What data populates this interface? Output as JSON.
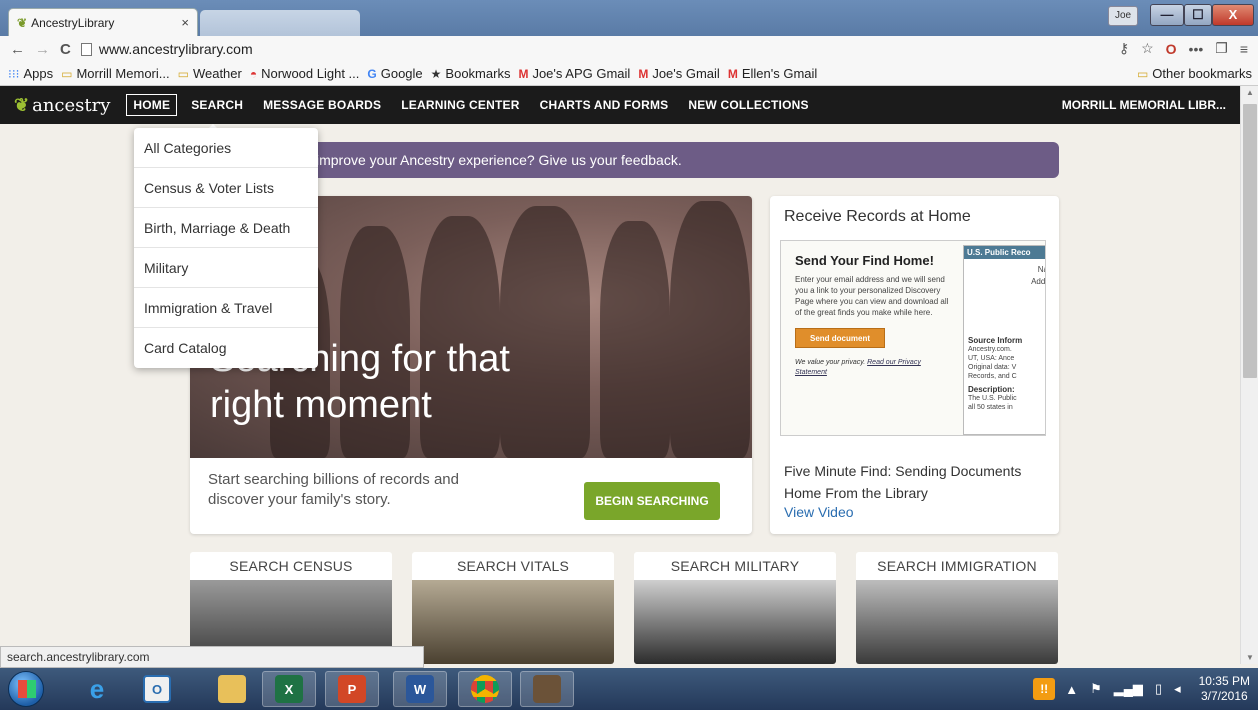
{
  "browser": {
    "tab_title": "AncestryLibrary",
    "tab_close": "×",
    "url": "www.ancestrylibrary.com",
    "user_badge": "Joe",
    "min": "—",
    "max": "☐",
    "close": "X",
    "back": "←",
    "forward": "→",
    "reload": "C",
    "bookmarks": [
      {
        "icon": "apps-icon",
        "label": "Apps"
      },
      {
        "icon": "folder-icon",
        "label": "Morrill Memori..."
      },
      {
        "icon": "folder-icon",
        "label": "Weather"
      },
      {
        "icon": "norwood-icon",
        "label": "Norwood Light ..."
      },
      {
        "icon": "google-icon",
        "label": "Google"
      },
      {
        "icon": "star-icon",
        "label": "Bookmarks"
      },
      {
        "icon": "gmail-icon",
        "label": "Joe's APG Gmail"
      },
      {
        "icon": "gmail-icon",
        "label": "Joe's Gmail"
      },
      {
        "icon": "gmail-icon",
        "label": "Ellen's Gmail"
      }
    ],
    "other_bookmarks": "Other bookmarks",
    "status_url": "search.ancestrylibrary.com"
  },
  "site": {
    "logo": "ancestry",
    "nav": {
      "home": "HOME",
      "search": "SEARCH",
      "message_boards": "MESSAGE BOARDS",
      "learning_center": "LEARNING CENTER",
      "charts_forms": "CHARTS AND FORMS",
      "new_collections": "NEW COLLECTIONS",
      "library": "MORRILL MEMORIAL LIBR..."
    },
    "dropdown": [
      "All Categories",
      "Census & Voter Lists",
      "Birth, Marriage & Death",
      "Military",
      "Immigration & Travel",
      "Card Catalog"
    ],
    "feedback": "improve your Ancestry experience? Give us your feedback.",
    "hero": {
      "headline_1": "Searching for that",
      "headline_2": "right moment",
      "subtext": "Start searching billions of records and discover your family's story.",
      "button": "BEGIN SEARCHING"
    },
    "receive": {
      "title": "Receive Records at Home",
      "shot_heading": "Send Your Find Home!",
      "shot_text": "Enter your email address and we will send you a link to your personalized Discovery Page where you can view and download all of the great finds you make while here.",
      "shot_button": "Send document",
      "privacy_text": "We value your privacy.",
      "privacy_link": "Read our Privacy Statement",
      "record_header": "U.S. Public Reco",
      "record_na": "Na",
      "record_addr": "Addr",
      "source_label": "Source Inform",
      "source_text": "Ancestry.com.\nUT, USA: Ance\nOriginal data: V\nRecords, and C",
      "desc_label": "Description:",
      "desc_text": "The U.S. Public\nall 50 states in",
      "five_minute": "Five Minute Find: Sending Documents Home From the Library",
      "view_video": "View Video"
    },
    "tiles": [
      {
        "label": "SEARCH CENSUS"
      },
      {
        "label": "SEARCH VITALS"
      },
      {
        "label": "SEARCH MILITARY"
      },
      {
        "label": "SEARCH IMMIGRATION"
      }
    ]
  },
  "taskbar": {
    "apps": [
      "start",
      "internet-explorer",
      "outlook",
      "file-explorer",
      "excel",
      "powerpoint",
      "word",
      "chrome",
      "photo-app"
    ],
    "time": "10:35 PM",
    "date": "3/7/2016"
  },
  "colors": {
    "nav_bg": "#1b1b1b",
    "accent_green": "#7aa62a",
    "banner_purple": "#6d5c86",
    "link_blue": "#2a6db0"
  }
}
